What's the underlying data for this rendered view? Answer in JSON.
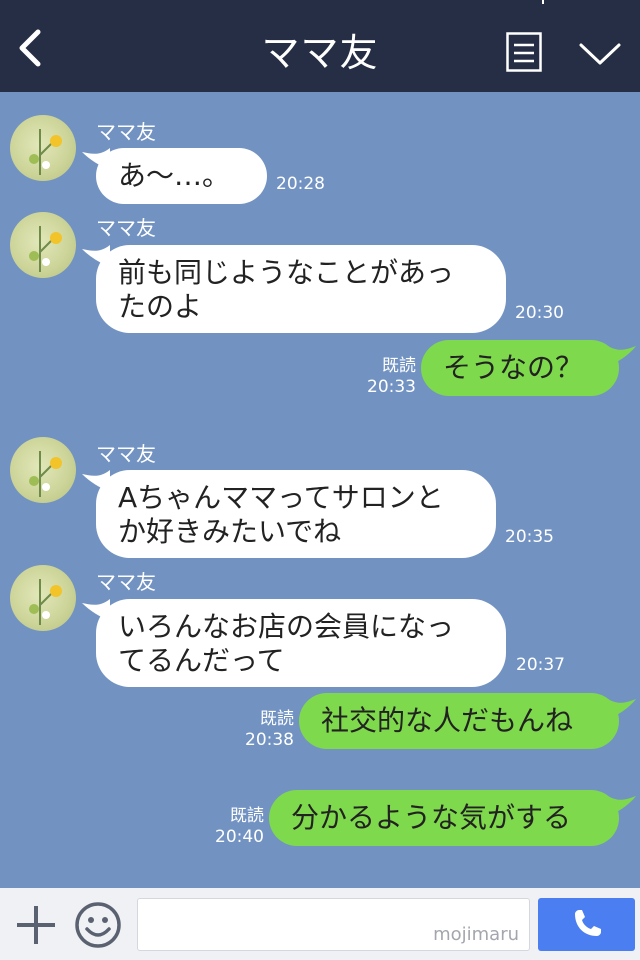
{
  "header": {
    "title": "ママ友",
    "back_icon": "chevron-left-icon",
    "menu_icon": "menu-icon",
    "collapse_icon": "chevron-down-icon"
  },
  "colors": {
    "header_bg": "#252e44",
    "chat_bg": "#7293c2",
    "incoming_bubble": "#ffffff",
    "outgoing_bubble": "#7fd94c",
    "send_button": "#4b7ef0"
  },
  "messages": [
    {
      "sender": "ママ友",
      "lines": [
        "あ〜…。"
      ],
      "time": "20:28"
    },
    {
      "sender": "ママ友",
      "lines": [
        "前も同じようなことがあっ",
        "たのよ"
      ],
      "time": "20:30"
    },
    {
      "text": "そうなの？",
      "read": "既読",
      "time": "20:33"
    },
    {
      "sender": "ママ友",
      "lines": [
        "Aちゃんママってサロンと",
        "か好きみたいでね"
      ],
      "time": "20:35"
    },
    {
      "sender": "ママ友",
      "lines": [
        "いろんなお店の会員になっ",
        "てるんだって"
      ],
      "time": "20:37"
    },
    {
      "text": "社交的な人だもんね",
      "read": "既読",
      "time": "20:38"
    },
    {
      "text": "分かるような気がする",
      "read": "既読",
      "time": "20:40"
    }
  ],
  "footer": {
    "plus_icon": "plus-icon",
    "emoji_icon": "smiley-icon",
    "input_value": "",
    "watermark": "mojimaru",
    "call_icon": "phone-icon"
  }
}
